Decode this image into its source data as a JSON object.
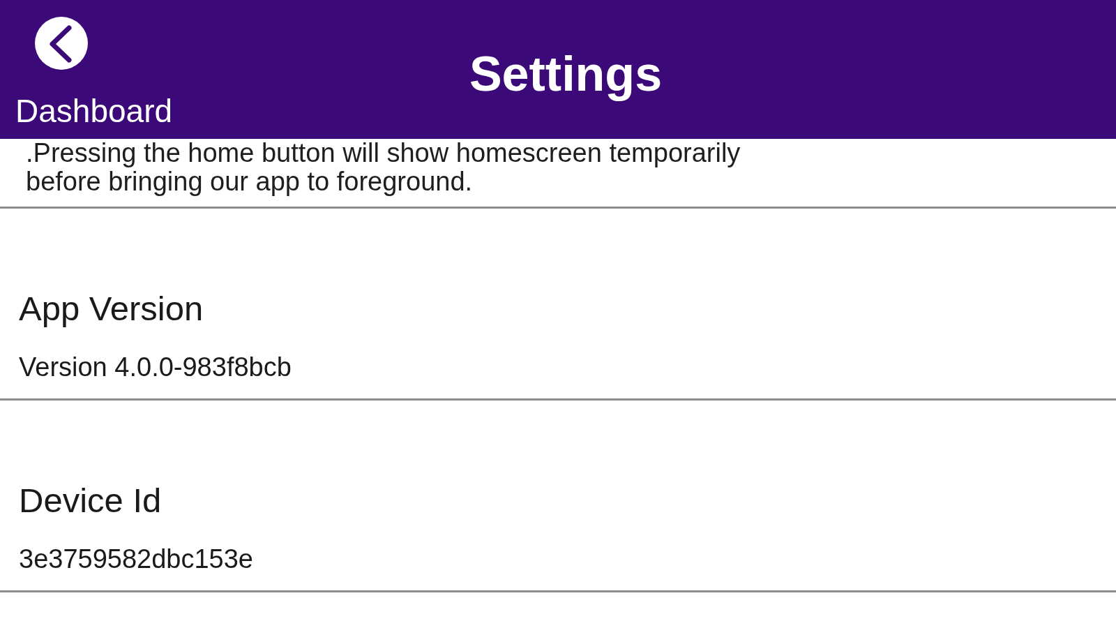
{
  "header": {
    "back_button": {
      "label": "Dashboard"
    },
    "title": "Settings"
  },
  "notice": {
    "text": ".Pressing the home button will show homescreen temporarily before bringing our app to foreground."
  },
  "settings": [
    {
      "title": "App Version",
      "value": "Version 4.0.0-983f8bcb"
    },
    {
      "title": "Device Id",
      "value": "3e3759582dbc153e"
    }
  ]
}
